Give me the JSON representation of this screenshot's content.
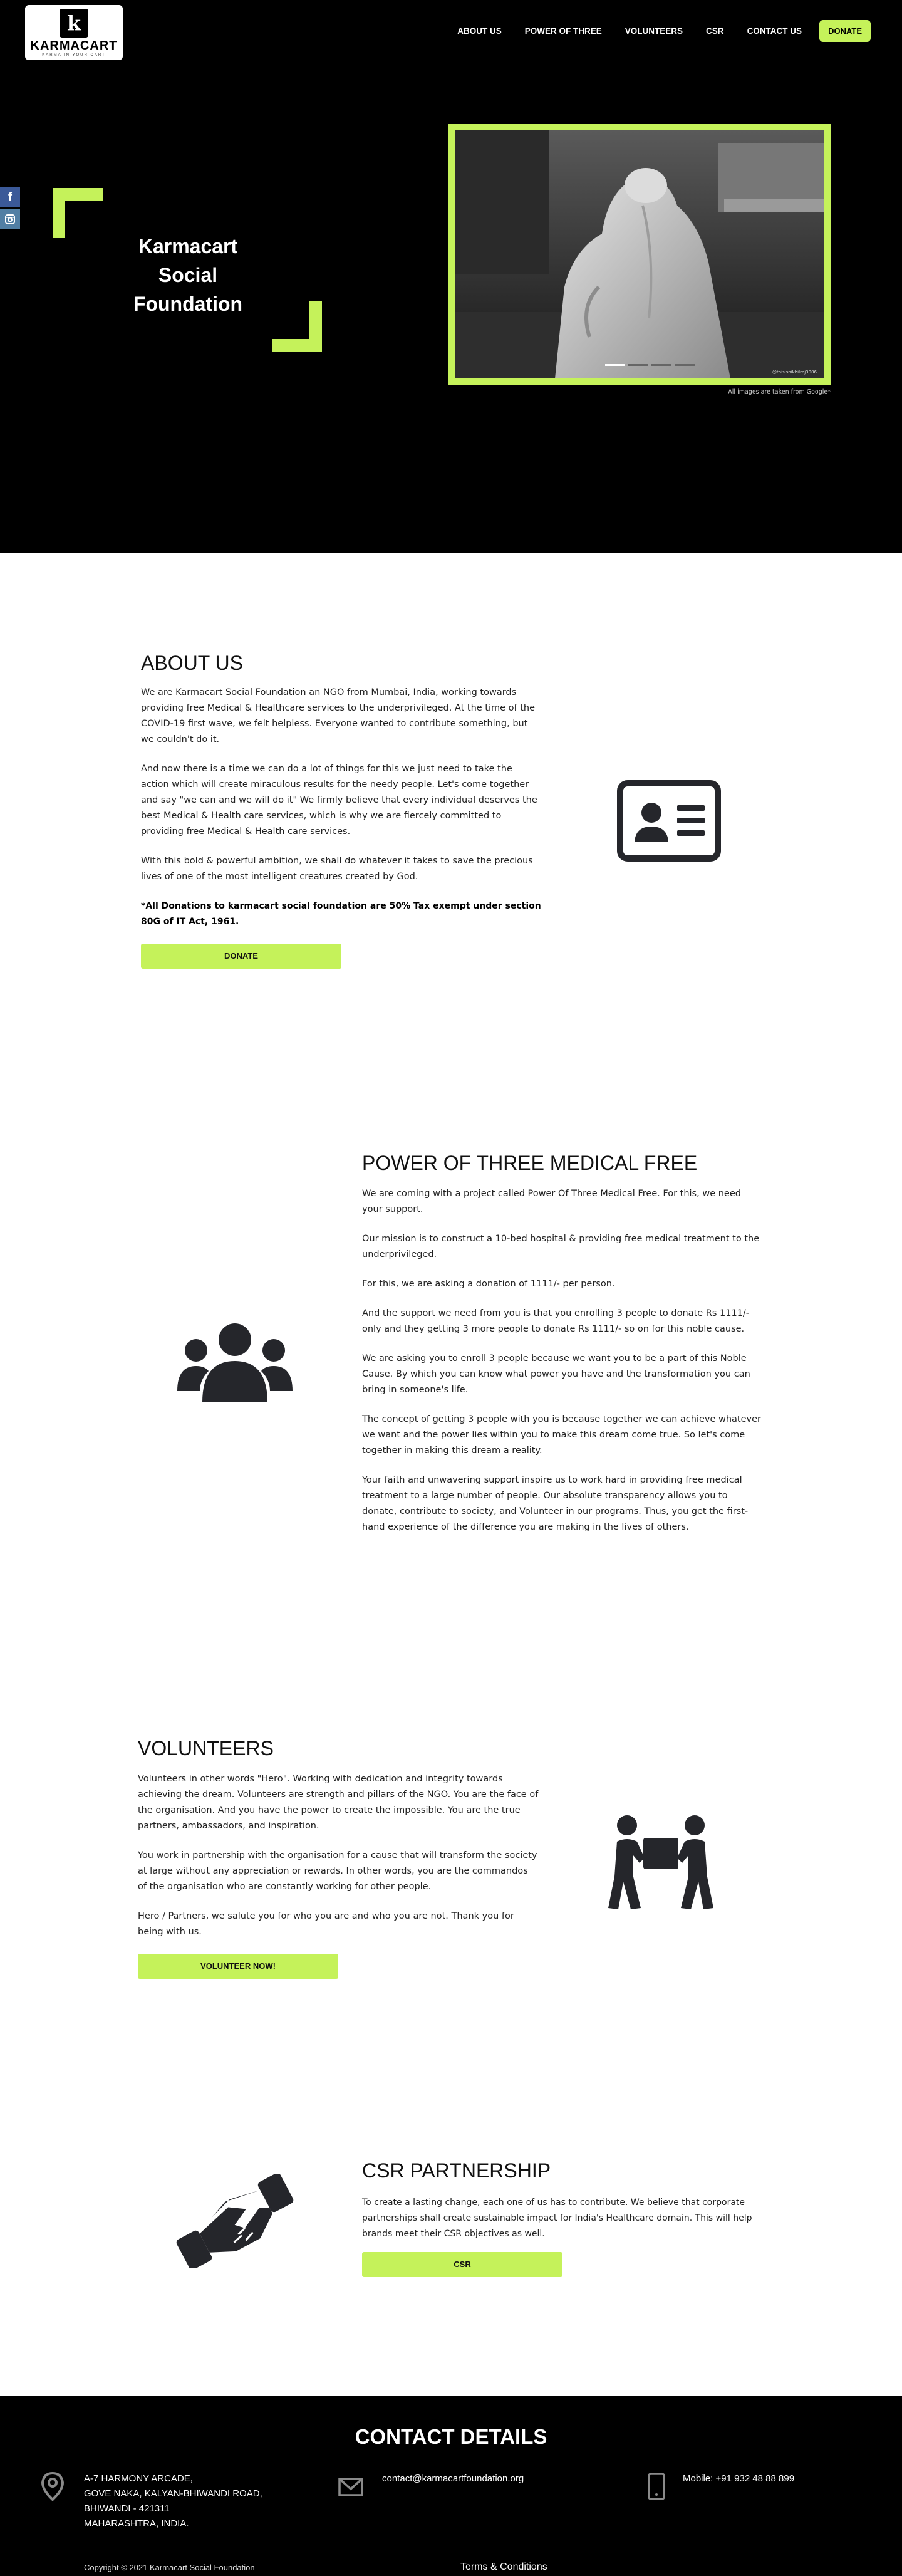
{
  "brand": {
    "name": "KARMACART",
    "tagline": "KARMA IN YOUR CART",
    "mark": "k"
  },
  "nav": {
    "items": [
      "ABOUT US",
      "POWER OF THREE",
      "VOLUNTEERS",
      "CSR",
      "CONTACT US"
    ],
    "donate_label": "DONATE"
  },
  "social": {
    "facebook": "f",
    "instagram": "◙"
  },
  "hero": {
    "title": "Karmacart Social Foundation",
    "photo_credit": "@thisisnikhilraj3006",
    "note": "All images are taken from Google*",
    "slides": 4,
    "active_slide": 1
  },
  "about": {
    "heading": "ABOUT US",
    "paragraphs": [
      "We are Karmacart Social Foundation an NGO from Mumbai, India, working towards providing free Medical & Healthcare services to the underprivileged. At the time of the COVID-19 first wave, we felt helpless. Everyone wanted to contribute something, but we couldn't do it.",
      "And now there is a time we can do a lot of things for this we just need to take the action which will create miraculous results for the needy people. Let's come together and say \"we can and we will do it\" We firmly believe that every individual deserves the best Medical & Health care services, which is why we are fiercely committed to providing free Medical & Health care services.",
      "With this bold & powerful ambition, we shall do whatever it takes to save the precious lives of one of the most intelligent creatures created by God."
    ],
    "tax_note": "*All Donations to karmacart social foundation are 50% Tax exempt under section 80G of IT Act, 1961.",
    "button": "DONATE",
    "icon": "id-card-icon"
  },
  "power": {
    "heading": "POWER OF THREE MEDICAL FREE",
    "paragraphs": [
      "We are coming with a project called Power Of Three Medical Free. For this, we need your support.",
      "Our mission is to construct a 10-bed hospital & providing free medical treatment to the underprivileged.",
      "For this, we are asking a donation of 1111/- per person.",
      "And the support we need from you is that you enrolling 3 people to donate Rs 1111/- only and they getting 3 more people to donate Rs 1111/- so on for this noble cause.",
      "We are asking you to enroll 3 people because we want you to be a part of this Noble Cause. By which you can know what power you have and the transformation you can bring in someone's life.",
      "The concept of getting 3 people with you is because together we can achieve whatever we want and the power lies within you to make this dream come true. So let's come together in making this dream a reality.",
      "Your faith and unwavering support inspire us to work hard in providing free medical treatment to a large number of people. Our absolute transparency allows you to donate, contribute to society, and Volunteer in our programs. Thus, you get the first-hand experience of the difference you are making in the lives of others."
    ],
    "icon": "group-icon"
  },
  "volunteers": {
    "heading": "VOLUNTEERS",
    "paragraphs": [
      "Volunteers in other words \"Hero\". Working with dedication and integrity towards achieving the dream. Volunteers are strength and pillars of the NGO. You are the face of the organisation. And you have the power to create the impossible. You are the true partners, ambassadors, and inspiration.",
      "You work in partnership with the organisation for a cause that will transform the society at large without any appreciation or rewards. In other words, you are the commandos of the organisation who are constantly working for other people.",
      "Hero / Partners, we salute you for who you are and who you are not. Thank you for being with us."
    ],
    "button": "VOLUNTEER NOW!",
    "icon": "people-carry-box-icon"
  },
  "csr": {
    "heading": "CSR PARTNERSHIP",
    "paragraph": "To create a lasting change, each one of us has to contribute. We believe that corporate partnerships shall create sustainable impact for India's Healthcare domain. This will help brands meet their CSR objectives as well.",
    "button": "CSR",
    "icon": "handshake-icon"
  },
  "contact": {
    "heading": "CONTACT DETAILS",
    "address_lines": [
      "A-7 HARMONY ARCADE,",
      "GOVE NAKA, KALYAN-BHIWANDI ROAD,",
      "BHIWANDI - 421311",
      "MAHARASHTRA, INDIA."
    ],
    "email": "contact@karmacartfoundation.org",
    "phone": "Mobile: +91 932 48 88 899"
  },
  "footer": {
    "copyright": "Copyright © 2021 Karmacart Social Foundation",
    "terms": "Terms & Conditions"
  },
  "colors": {
    "accent": "#c5f25a",
    "dark": "#000000",
    "icon": "#25262b"
  }
}
